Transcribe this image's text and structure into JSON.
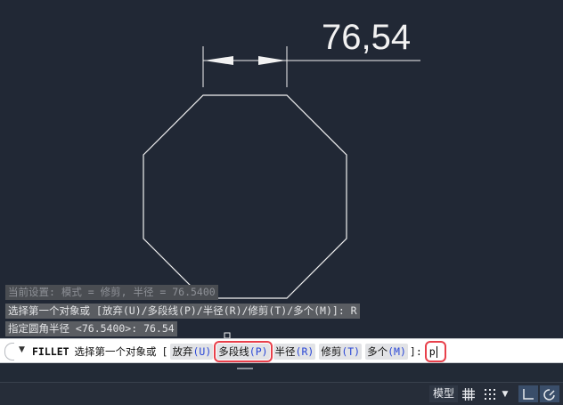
{
  "drawing": {
    "dimension_text": "76,54"
  },
  "command_history": [
    "当前设置: 模式 = 修剪, 半径 = 76.5400",
    "选择第一个对象或 [放弃(U)/多段线(P)/半径(R)/修剪(T)/多个(M)]: R",
    "指定圆角半径 <76.5400>: 76.54"
  ],
  "command_line": {
    "command_name": "FILLET",
    "prompt": "选择第一个对象或",
    "bracket_open": "[",
    "options": [
      {
        "label": "放弃",
        "key": "(U)"
      },
      {
        "label": "多段线",
        "key": "(P)"
      },
      {
        "label": "半径",
        "key": "(R)"
      },
      {
        "label": "修剪",
        "key": "(T)"
      },
      {
        "label": "多个",
        "key": "(M)"
      }
    ],
    "bracket_close": "]:",
    "input_value": "p"
  },
  "statusbar": {
    "model_label": "模型"
  },
  "colors": {
    "canvas_bg": "#212835",
    "highlight": "#e8404b",
    "option_key": "#2a47d6"
  }
}
